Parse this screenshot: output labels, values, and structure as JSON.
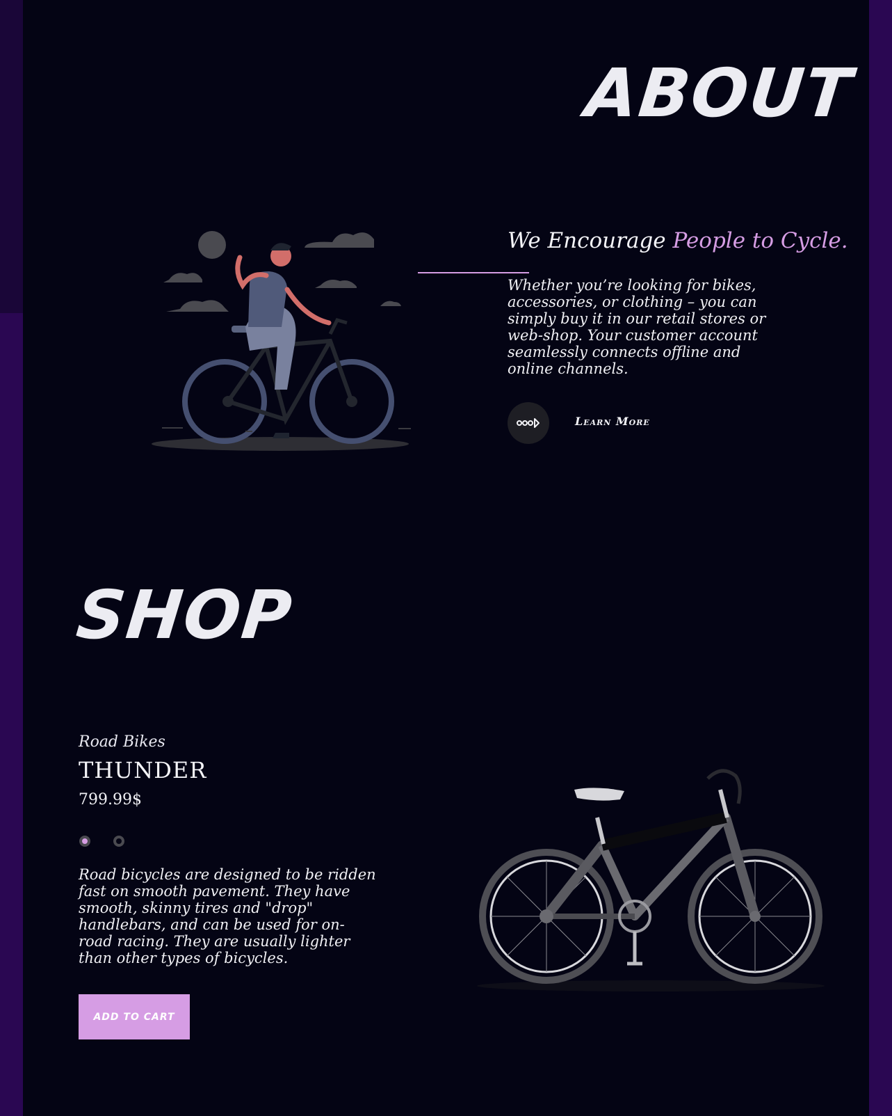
{
  "about": {
    "title": "ABOUT",
    "heading_plain": "We Encourage ",
    "heading_accent": "People to Cycle.",
    "body": "Whether you’re looking for bikes, accessories, or clothing – you can simply buy it in our retail stores or web-shop. Your customer account seamlessly connects offline and online channels.",
    "learn_more_label": "Learn More",
    "learn_more_icon": "arrow-right-icon",
    "illustration": "cyclist-illustration"
  },
  "shop": {
    "title": "SHOP",
    "category": "Road Bikes",
    "product_name": "THUNDER",
    "price": "799.99$",
    "swatches": [
      "#d69de4",
      "#040414"
    ],
    "description": "Road bicycles are designed to be ridden fast on smooth pavement. They have smooth, skinny tires and \"drop\" handlebars, and can be used for on-road racing. They are usually lighter than other types of bicycles.",
    "add_to_cart_label": "ADD TO CART",
    "product_image": "bicycle-image"
  },
  "colors": {
    "accent": "#d69de4",
    "background": "#040414",
    "frame": "#2a0752"
  }
}
